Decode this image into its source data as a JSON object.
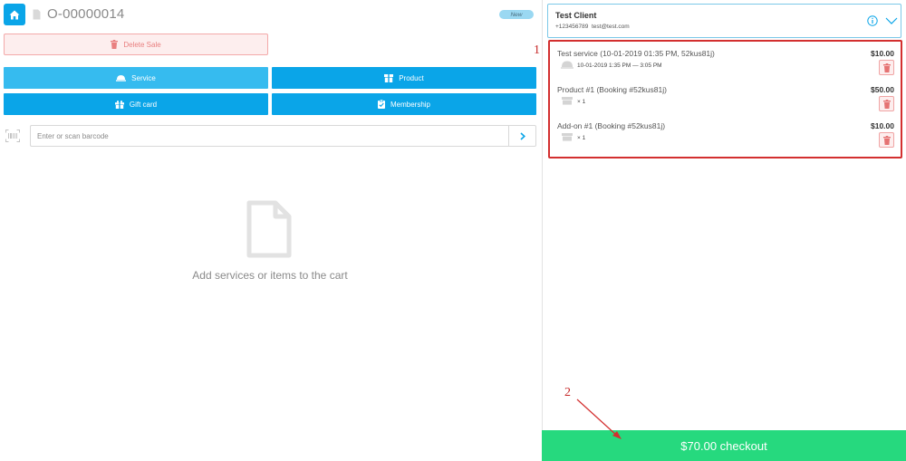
{
  "header": {
    "order_number": "O-00000014",
    "status_badge": "New"
  },
  "actions": {
    "delete_sale_label": "Delete Sale"
  },
  "tiles": {
    "service": "Service",
    "product": "Product",
    "gift_card": "Gift card",
    "membership": "Membership"
  },
  "barcode": {
    "placeholder": "Enter or scan barcode",
    "value": ""
  },
  "cart_empty_text": "Add services or items to the cart",
  "client": {
    "name": "Test Client",
    "phone": "+123456789",
    "email": "test@test.com"
  },
  "cart_items": [
    {
      "name": "Test service (10-01-2019 01:35 PM, 52kus81j)",
      "price": "$10.00",
      "sub": "10-01-2019 1:35 PM — 3:05 PM"
    },
    {
      "name": "Product #1 (Booking #52kus81j)",
      "price": "$50.00",
      "sub": "× 1"
    },
    {
      "name": "Add-on #1 (Booking #52kus81j)",
      "price": "$10.00",
      "sub": "× 1"
    }
  ],
  "annotations": {
    "one": "1",
    "two": "2"
  },
  "checkout_label": "$70.00 checkout",
  "colors": {
    "primary": "#0aa5e8",
    "primary_light": "#36bbef",
    "checkout": "#26d97e",
    "danger": "#d32f2f",
    "annotation": "#c62828"
  },
  "icons": {
    "home": "home-icon",
    "document": "document-icon",
    "trash": "trash-icon",
    "service": "service-bell-icon",
    "product": "box-icon",
    "gift": "gift-icon",
    "membership": "clipboard-check-icon",
    "barcode": "barcode-icon",
    "chevron_right": "chevron-right-icon",
    "info": "info-icon",
    "chevron_down": "chevron-down-icon"
  }
}
